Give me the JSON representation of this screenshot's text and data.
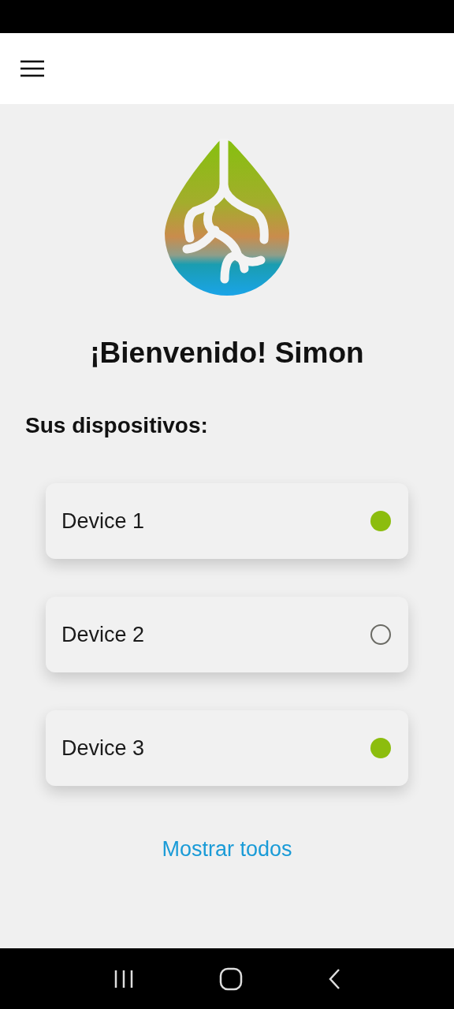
{
  "header": {
    "menu": true
  },
  "welcome": "¡Bienvenido! Simon",
  "section_title": "Sus dispositivos:",
  "devices": [
    {
      "name": "Device 1",
      "online": true
    },
    {
      "name": "Device 2",
      "online": false
    },
    {
      "name": "Device 3",
      "online": true
    }
  ],
  "show_all_link": "Mostrar todos"
}
